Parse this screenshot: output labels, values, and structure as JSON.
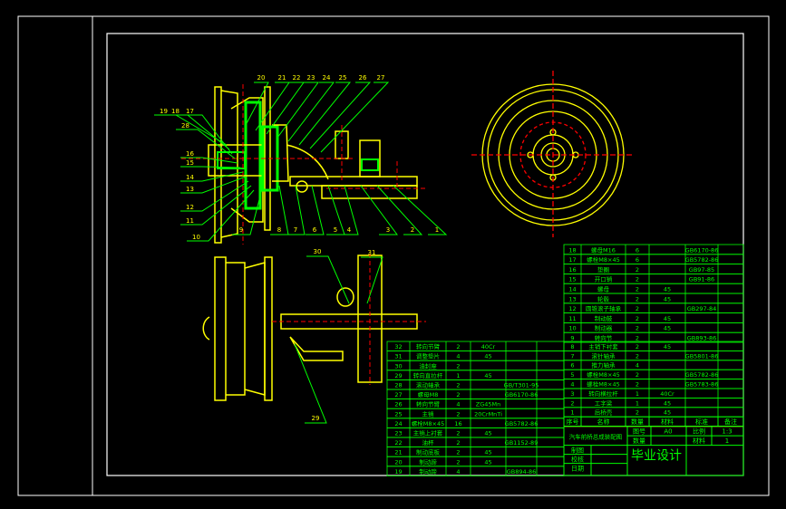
{
  "colors": {
    "background": "#000000",
    "frame": "#ffffff",
    "outline": "#ffff00",
    "leader": "#00ff00",
    "centerline": "#ff0000",
    "grid": "#00ff00"
  },
  "balloons": {
    "top": [
      "20",
      "21",
      "22",
      "23",
      "24",
      "25",
      "26",
      "27"
    ],
    "left": [
      "19",
      "18",
      "17",
      "28",
      "16",
      "15",
      "14",
      "13",
      "12",
      "11",
      "10"
    ],
    "bottom": [
      "9",
      "8",
      "7",
      "6",
      "5",
      "4",
      "3",
      "2",
      "1"
    ],
    "lower_view": [
      "30",
      "31",
      "29"
    ]
  },
  "parts_upper": [
    {
      "no": "18",
      "name": "螺母M16",
      "qty": "6",
      "material": "",
      "standard": "GB6170-86"
    },
    {
      "no": "17",
      "name": "螺栓M8×45",
      "qty": "6",
      "material": "",
      "standard": "GB5782-86"
    },
    {
      "no": "16",
      "name": "垫圈",
      "qty": "2",
      "material": "",
      "standard": "GB97-85"
    },
    {
      "no": "15",
      "name": "开口销",
      "qty": "2",
      "material": "",
      "standard": "GB91-86"
    },
    {
      "no": "14",
      "name": "螺母",
      "qty": "2",
      "material": "45",
      "standard": ""
    },
    {
      "no": "13",
      "name": "轮毂",
      "qty": "2",
      "material": "45",
      "standard": ""
    },
    {
      "no": "12",
      "name": "圆锥滚子轴承",
      "qty": "2",
      "material": "",
      "standard": "GB297-84"
    },
    {
      "no": "11",
      "name": "制动鼓",
      "qty": "2",
      "material": "45",
      "standard": ""
    },
    {
      "no": "10",
      "name": "制动器",
      "qty": "2",
      "material": "45",
      "standard": ""
    },
    {
      "no": "9",
      "name": "转向节",
      "qty": "2",
      "material": "",
      "standard": "GB893-86"
    }
  ],
  "parts_lower_right": [
    {
      "no": "8",
      "name": "主销下衬套",
      "qty": "2",
      "material": "45",
      "standard": ""
    },
    {
      "no": "7",
      "name": "滚针轴承",
      "qty": "2",
      "material": "",
      "standard": "GB5801-86"
    },
    {
      "no": "6",
      "name": "推力轴承",
      "qty": "4",
      "material": "",
      "standard": ""
    },
    {
      "no": "5",
      "name": "螺栓M8×45",
      "qty": "2",
      "material": "",
      "standard": "GB5782-86"
    },
    {
      "no": "4",
      "name": "螺栓M8×45",
      "qty": "2",
      "material": "",
      "standard": "GB5783-86"
    },
    {
      "no": "3",
      "name": "转向横拉杆",
      "qty": "1",
      "material": "40Cr",
      "standard": ""
    },
    {
      "no": "2",
      "name": "工字梁",
      "qty": "1",
      "material": "45",
      "standard": ""
    },
    {
      "no": "1",
      "name": "后桥壳",
      "qty": "2",
      "material": "45",
      "standard": ""
    }
  ],
  "parts_lower_left": [
    {
      "no": "32",
      "name": "转向节臂",
      "qty": "2",
      "material": "40Cr",
      "standard": ""
    },
    {
      "no": "31",
      "name": "调整垫片",
      "qty": "4",
      "material": "45",
      "standard": ""
    },
    {
      "no": "30",
      "name": "油封座",
      "qty": "2",
      "material": "",
      "standard": ""
    },
    {
      "no": "29",
      "name": "转向直拉杆",
      "qty": "1",
      "material": "45",
      "standard": ""
    },
    {
      "no": "28",
      "name": "滚动轴承",
      "qty": "2",
      "material": "",
      "standard": "GB/T301-95"
    },
    {
      "no": "27",
      "name": "螺母M8",
      "qty": "2",
      "material": "",
      "standard": "GB6170-86"
    },
    {
      "no": "26",
      "name": "转向节臂",
      "qty": "4",
      "material": "ZG45Mn",
      "standard": ""
    },
    {
      "no": "25",
      "name": "主销",
      "qty": "2",
      "material": "20CrMnTi",
      "standard": ""
    },
    {
      "no": "24",
      "name": "螺栓M8×45",
      "qty": "16",
      "material": "",
      "standard": "GB5782-86"
    },
    {
      "no": "23",
      "name": "主销上衬套",
      "qty": "2",
      "material": "45",
      "standard": ""
    },
    {
      "no": "22",
      "name": "油杯",
      "qty": "2",
      "material": "",
      "standard": "GB1152-89"
    },
    {
      "no": "21",
      "name": "制动底板",
      "qty": "2",
      "material": "45",
      "standard": ""
    },
    {
      "no": "20",
      "name": "制动蹄",
      "qty": "2",
      "material": "45",
      "standard": ""
    },
    {
      "no": "19",
      "name": "制动蹄",
      "qty": "4",
      "material": "",
      "standard": "GB894-86"
    }
  ],
  "header": {
    "no": "序号",
    "name": "名称",
    "qty": "数量",
    "material": "材料",
    "standard": "标准",
    "remark": "备注"
  },
  "title_block": {
    "drawing_title": "汽车前桥总成装配图",
    "drawing_no_label": "图号",
    "drawing_no": "A0",
    "scale_label": "比例",
    "scale": "1:3",
    "material_label": "材料",
    "qty_label": "数量",
    "qty": "1",
    "drawn_label": "制图",
    "checked_label": "校核",
    "date_label": "日期",
    "project": "毕业设计"
  }
}
